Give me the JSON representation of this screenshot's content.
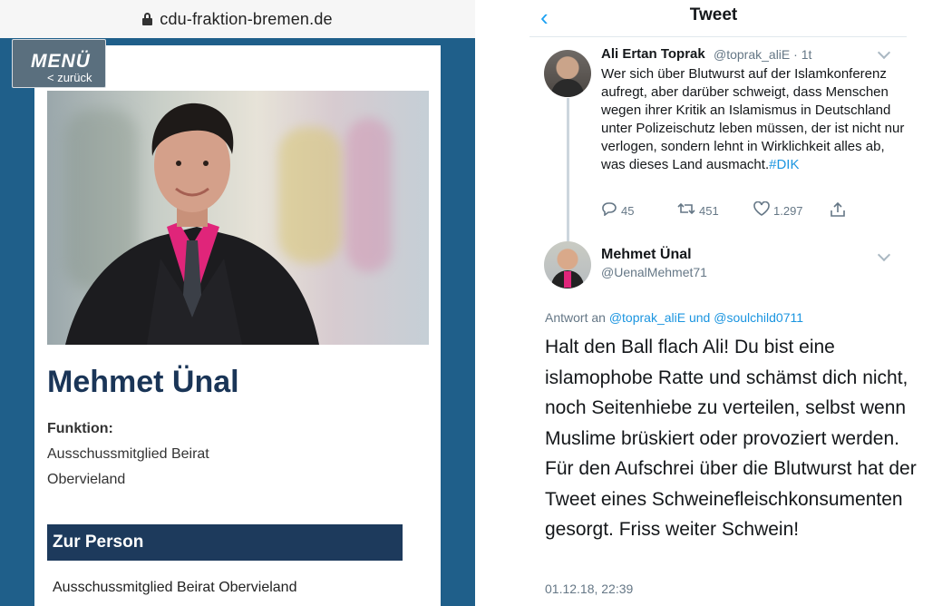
{
  "browser": {
    "url": "cdu-fraktion-bremen.de"
  },
  "left": {
    "menu_label": "MENÜ",
    "back_label": "< zurück",
    "name": "Mehmet Ünal",
    "function_title": "Funktion:",
    "function_line1": "Ausschussmitglied Beirat",
    "function_line2": "Obervieland",
    "section_title": "Zur Person",
    "person_line": "Ausschussmitglied Beirat Obervieland"
  },
  "twitter": {
    "header_title": "Tweet",
    "tweet1": {
      "author": "Ali Ertan Toprak",
      "handle_time": "@toprak_aliE · 1t",
      "text": "Wer sich über Blutwurst auf der Islamkonferenz aufregt, aber darüber schweigt, dass Menschen wegen ihrer Kritik an Islamismus in Deutschland unter Polizeischutz leben müssen, der ist nicht nur verlogen, sondern lehnt in Wirklichkeit alles ab, was dieses Land ausmacht.",
      "hashtag": "#DIK",
      "replies": "45",
      "retweets": "451",
      "likes": "1.297"
    },
    "tweet2": {
      "author": "Mehmet Ünal",
      "handle": "@UenalMehmet71",
      "reply_prefix": "Antwort an",
      "mention1": "@toprak_aliE",
      "reply_join": "und",
      "mention2": "@soulchild0711",
      "text": "Halt den Ball flach Ali! Du bist eine islamophobe Ratte und schämst dich nicht, noch Seitenhiebe zu verteilen, selbst wenn Muslime brüskiert oder provoziert werden. Für den Aufschrei über die Blutwurst hat der Tweet eines Schweinefleischkonsumenten gesorgt. Friss weiter Schwein!",
      "timestamp": "01.12.18, 22:39"
    }
  },
  "colors": {
    "brand_blue": "#1f5f8a",
    "heading_navy": "#1a3557",
    "twitter_blue": "#1da1f2"
  }
}
